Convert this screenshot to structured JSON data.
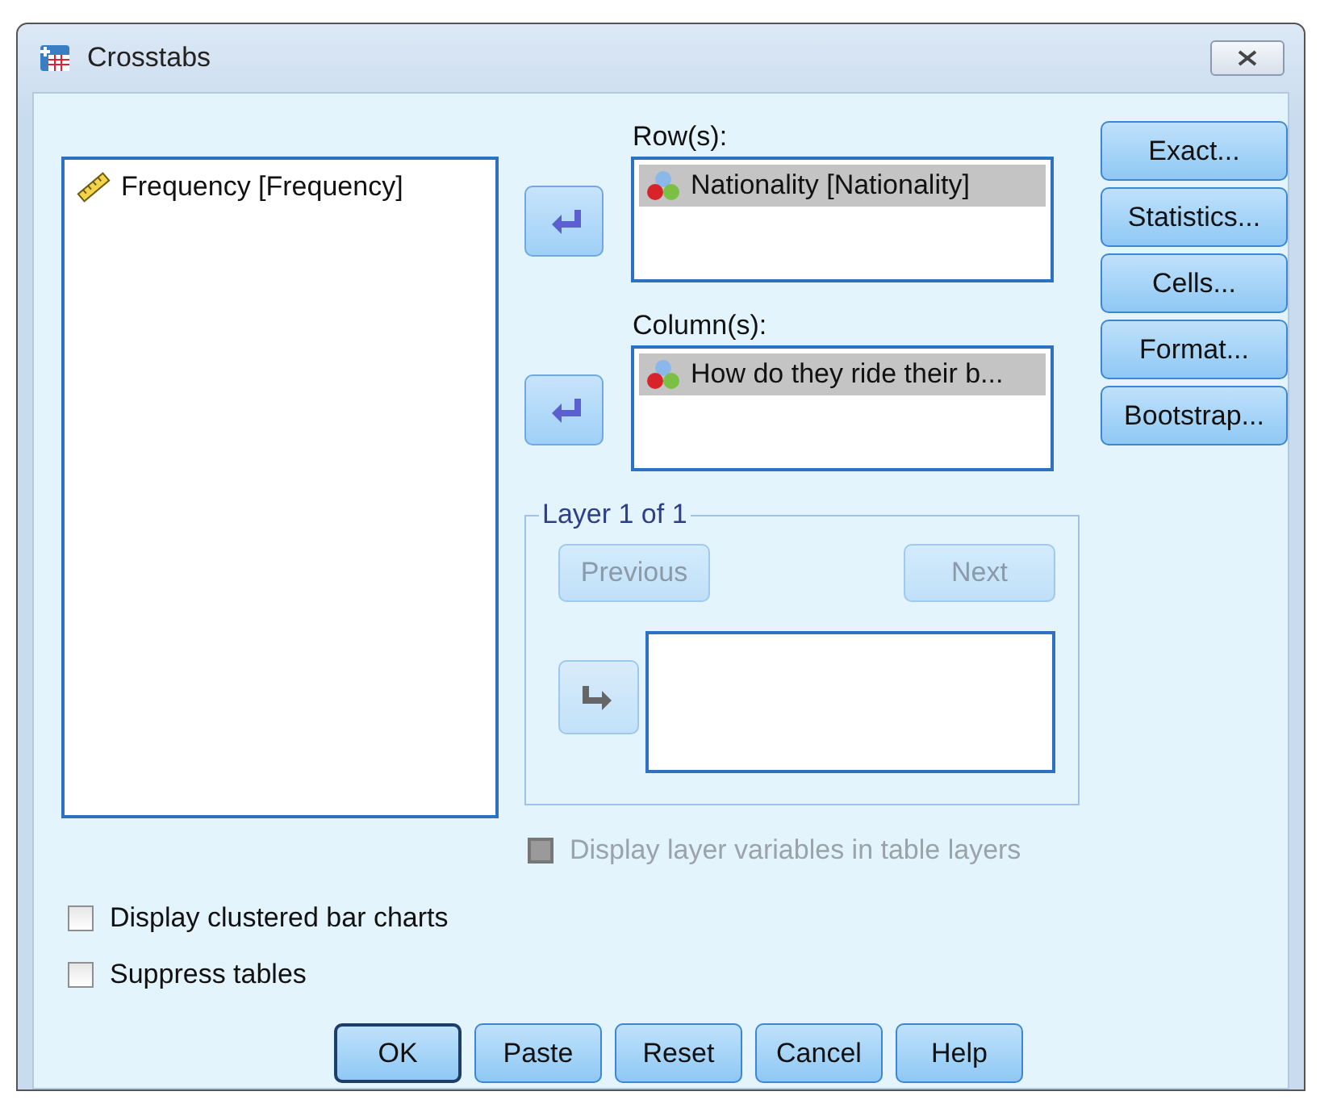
{
  "window": {
    "title": "Crosstabs"
  },
  "source_list": {
    "items": [
      {
        "label": "Frequency [Frequency]",
        "kind": "scale",
        "selected": false
      }
    ]
  },
  "rows": {
    "label": "Row(s):",
    "items": [
      {
        "label": "Nationality [Nationality]",
        "kind": "nominal",
        "selected": true
      }
    ]
  },
  "columns": {
    "label": "Column(s):",
    "items": [
      {
        "label": "How do they ride their b...",
        "kind": "nominal",
        "selected": true
      }
    ]
  },
  "layer": {
    "title": "Layer 1 of 1",
    "move_disabled": true,
    "buttons": [
      {
        "label": "Previous",
        "disabled": true
      },
      {
        "label": "Next",
        "disabled": true
      }
    ]
  },
  "display_layer": {
    "label": "Display layer variables in table layers",
    "checked": false,
    "disabled": true
  },
  "options": [
    {
      "label": "Display clustered bar charts",
      "checked": false
    },
    {
      "label": "Suppress tables",
      "checked": false
    }
  ],
  "side_buttons": [
    "Exact...",
    "Statistics...",
    "Cells...",
    "Format...",
    "Bootstrap..."
  ],
  "footer_buttons": [
    {
      "label": "OK",
      "default": true
    },
    {
      "label": "Paste",
      "default": false
    },
    {
      "label": "Reset",
      "default": false
    },
    {
      "label": "Cancel",
      "default": false
    },
    {
      "label": "Help",
      "default": false
    }
  ]
}
